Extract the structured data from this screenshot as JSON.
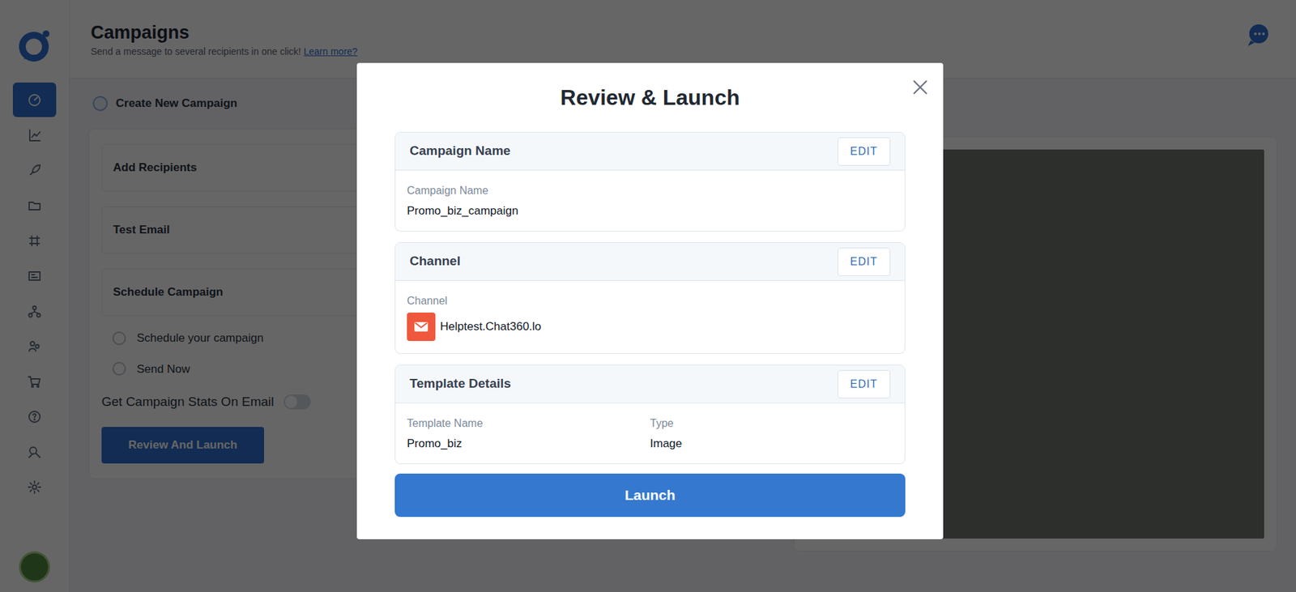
{
  "header": {
    "title": "Campaigns",
    "subtitle": "Send a message to several recipients in one click!",
    "link": "Learn more?"
  },
  "sidebar": {
    "items": [
      {
        "selected": true
      },
      {
        "selected": false
      },
      {
        "selected": false
      },
      {
        "selected": false
      },
      {
        "selected": false
      },
      {
        "selected": false
      },
      {
        "selected": false
      },
      {
        "selected": false
      },
      {
        "selected": false
      },
      {
        "selected": false
      },
      {
        "selected": false
      },
      {
        "selected": false
      }
    ]
  },
  "campaign": {
    "heading": "Create New Campaign",
    "sections": [
      {
        "title": "Add Recipients"
      },
      {
        "title": "Test Email"
      },
      {
        "title": "Schedule Campaign"
      }
    ],
    "schedule_options": [
      {
        "label": "Schedule your campaign",
        "selected": false
      },
      {
        "label": "Send Now",
        "selected": false
      }
    ],
    "stats_toggle": {
      "label": "Get Campaign Stats On Email",
      "on": false
    },
    "review_button": "Review And Launch"
  },
  "modal": {
    "title": "Review & Launch",
    "sections": [
      {
        "kind": "text",
        "title": "Campaign Name",
        "edit": "EDIT",
        "fields": [
          {
            "label": "Campaign Name",
            "value": "Promo_biz_campaign"
          }
        ]
      },
      {
        "kind": "channel",
        "title": "Channel",
        "edit": "EDIT",
        "fields": [
          {
            "label": "Channel",
            "value": "Helptest.Chat360.lo"
          }
        ]
      },
      {
        "kind": "grid",
        "title": "Template Details",
        "edit": "EDIT",
        "fields": [
          {
            "label": "Template Name",
            "value": "Promo_biz"
          },
          {
            "label": "Type",
            "value": "Image"
          }
        ]
      }
    ],
    "launch": "Launch"
  }
}
